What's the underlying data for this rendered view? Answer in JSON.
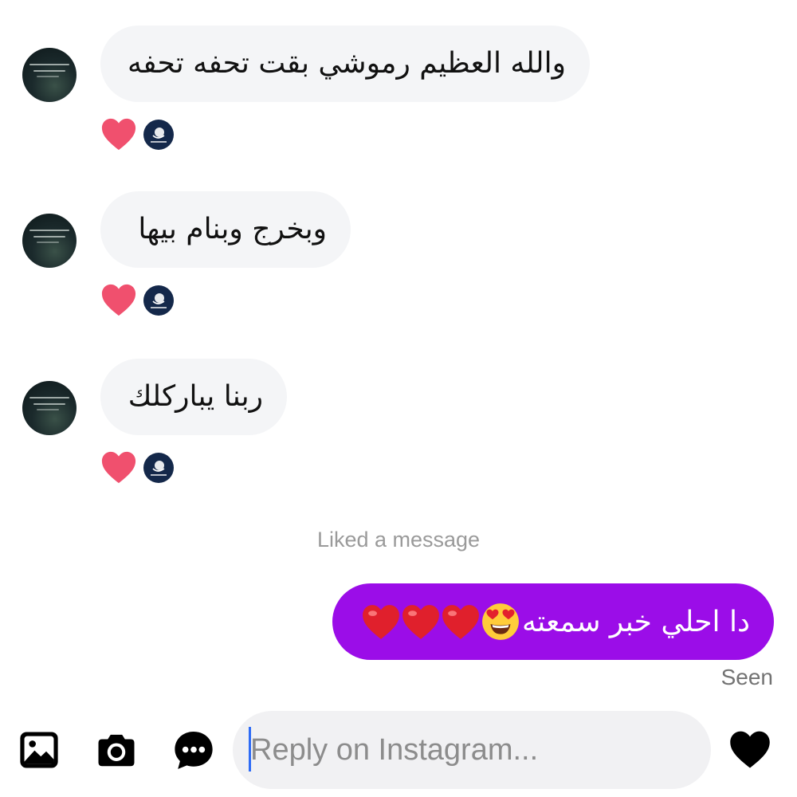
{
  "messages_in": [
    {
      "text": "والله العظيم رموشي بقت تحفه تحفه",
      "reaction": "red-heart"
    },
    {
      "text": "وبخرج وبنام بيها",
      "reaction": "red-heart"
    },
    {
      "text": "ربنا يباركلك",
      "reaction": "red-heart"
    }
  ],
  "system_note": "Liked a message",
  "message_out": {
    "text": "دا احلي خبر سمعته",
    "emojis": [
      "smiling-face-with-heart-eyes",
      "red-heart",
      "red-heart",
      "red-heart"
    ]
  },
  "seen_label": "Seen",
  "composer": {
    "placeholder": "Reply on Instagram..."
  },
  "colors": {
    "outgoing_bubble": "#9b0de8",
    "incoming_bubble": "#f4f5f7",
    "heart_reaction": "#f0506e",
    "caret": "#2f6cf6"
  },
  "icons": {
    "gallery": "image-icon",
    "camera": "camera-icon",
    "sticker": "chat-bubble-icon",
    "like": "heart-icon"
  }
}
